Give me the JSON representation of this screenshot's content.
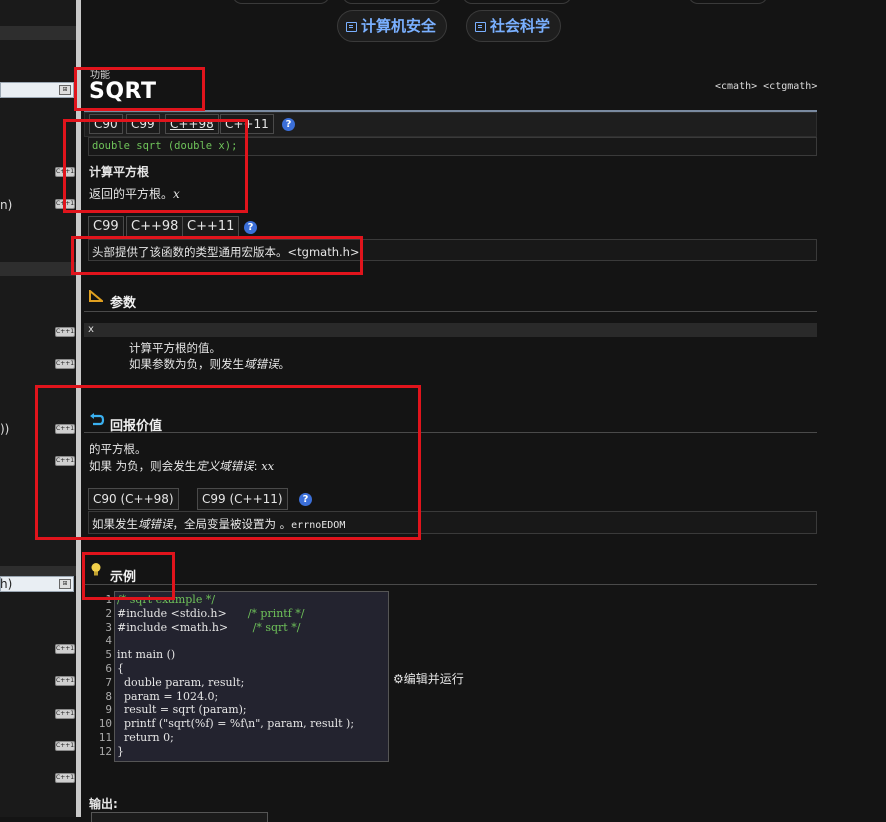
{
  "top_categories": [
    {
      "label": "计算机安全",
      "icon": "book-icon"
    },
    {
      "label": "社会科学",
      "icon": "book-icon"
    }
  ],
  "sidebar": {
    "texts": [
      "n)",
      "))",
      "h)"
    ],
    "tags": [
      "C++11",
      "C++11",
      "C++11",
      "C++11",
      "C++11",
      "C++11",
      "C++11",
      "C++11",
      "C++11",
      "C++11",
      "C++11",
      "C++11"
    ]
  },
  "func": {
    "kind": "功能",
    "name": "SQRT",
    "headers": "<cmath> <ctgmath>"
  },
  "standards_1": [
    "C90",
    "C99",
    "C++98",
    "C++11"
  ],
  "signature": "double sqrt (double x);",
  "summary_title": "计算平方根",
  "summary_text": "返回的平方根。",
  "summary_var": "x",
  "standards_2": [
    "C99",
    "C++98",
    "C++11"
  ],
  "tgmath_note": "头部提供了该函数的类型通用宏版本。<tgmath.h>",
  "params": {
    "title": "参数",
    "name": "x",
    "desc1": "计算平方根的值。",
    "desc2_a": "如果参数为负，则发生",
    "desc2_b": "域错误",
    "desc2_c": "。"
  },
  "return": {
    "title": "回报价值",
    "line1": "的平方根。",
    "line2_a": "如果 为负，则会发生",
    "line2_b": "定义域错误",
    "line2_c": ": ",
    "line2_d": "xx",
    "tabs": [
      "C90 (C++98)",
      "C99 (C++11)"
    ],
    "errno_a": "如果发生",
    "errno_b": "域错误",
    "errno_c": "，全局变量被设置为 。",
    "errno_d": "errnoEDOM"
  },
  "example": {
    "title": "示例",
    "line_numbers": [
      "1",
      "2",
      "3",
      "4",
      "5",
      "6",
      "7",
      "8",
      "9",
      "10",
      "11",
      "12"
    ],
    "run_label": "编辑并运行"
  },
  "output_label": "输出:"
}
